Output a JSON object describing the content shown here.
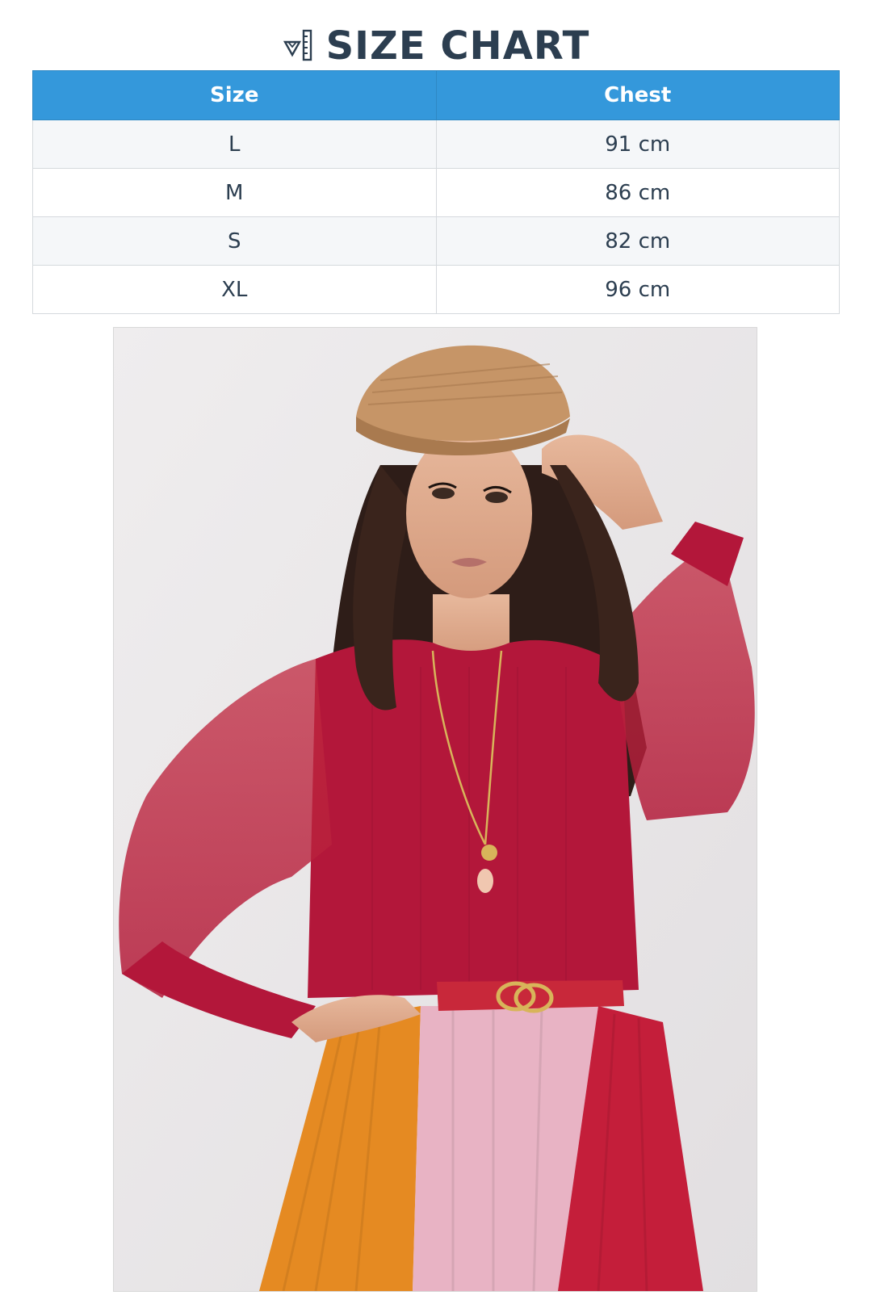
{
  "header": {
    "icon": "ruler-icon",
    "title": "SIZE CHART"
  },
  "table": {
    "columns": [
      "Size",
      "Chest"
    ],
    "rows": [
      {
        "size": "L",
        "chest": "91 cm"
      },
      {
        "size": "M",
        "chest": "86 cm"
      },
      {
        "size": "S",
        "chest": "82 cm"
      },
      {
        "size": "XL",
        "chest": "96 cm"
      }
    ]
  },
  "colors": {
    "header_bg": "#3498db",
    "title_text": "#2c3e50",
    "sweater": "#b3173a",
    "cap": "#c69567",
    "skirt_orange": "#e58a22",
    "skirt_pink": "#e8b3c4",
    "skirt_red": "#c41e3a"
  },
  "photo": {
    "subject": "product-model-photo"
  }
}
